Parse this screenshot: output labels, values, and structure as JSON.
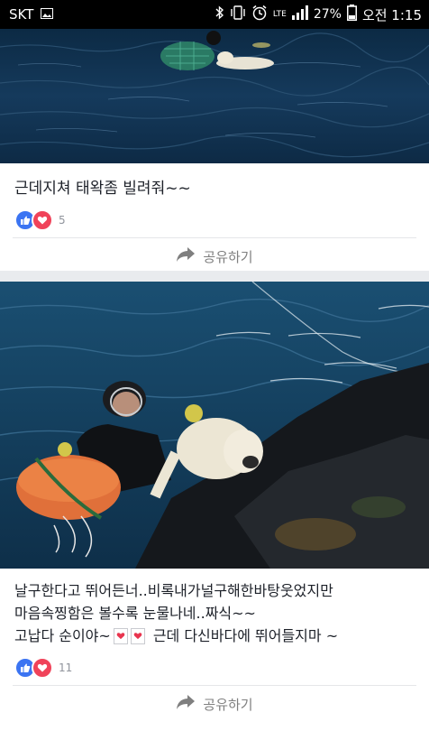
{
  "status_bar": {
    "carrier": "SKT",
    "network": "LTE",
    "battery": "27%",
    "time": "오전 1:15"
  },
  "posts": [
    {
      "caption": "근데지쳐 태왁좀 빌려줘~~",
      "reaction_count": "5",
      "share_label": "공유하기"
    },
    {
      "caption_line1": "날구한다고 뛰어든너..비록내가널구해한바탕웃었지만",
      "caption_line2": "마음속찡함은 볼수록 눈물나네..짜식~~",
      "caption_line3_a": "고납다 순이야~",
      "caption_line3_b": "근데 다신바다에 뛰어들지마 ~",
      "reaction_count": "11",
      "share_label": "공유하기"
    }
  ],
  "colors": {
    "like": "#3b74f2",
    "love": "#f0435a",
    "feed_bg": "#e9ebee"
  },
  "icons": [
    "image-icon",
    "bluetooth-icon",
    "vibrate-icon",
    "alarm-icon",
    "signal-icon",
    "battery-icon",
    "like-icon",
    "love-icon",
    "share-arrow-icon",
    "heart-emoji-icon"
  ]
}
